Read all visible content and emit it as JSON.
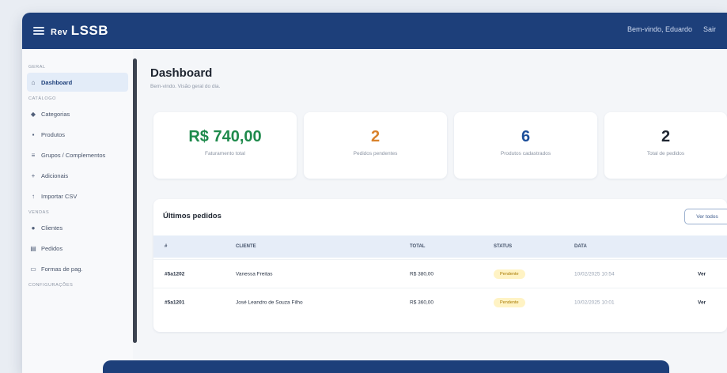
{
  "app": {
    "brand_prefix": "Rev",
    "brand_name": "LSSB",
    "user_label": "Bem-vindo, Eduardo",
    "user_extra": "Sair"
  },
  "sidebar": {
    "sections": [
      {
        "label": "GERAL",
        "items": [
          {
            "label": "Dashboard",
            "icon": "home-icon",
            "active": true
          }
        ]
      },
      {
        "label": "CATÁLOGO",
        "items": [
          {
            "label": "Categorias",
            "icon": "tag-icon"
          },
          {
            "label": "Produtos",
            "icon": "box-icon"
          },
          {
            "label": "Grupos / Complementos",
            "icon": "layers-icon"
          },
          {
            "label": "Adicionais",
            "icon": "plus-icon"
          },
          {
            "label": "Importar CSV",
            "icon": "upload-icon"
          }
        ]
      },
      {
        "label": "VENDAS",
        "items": [
          {
            "label": "Clientes",
            "icon": "users-icon"
          },
          {
            "label": "Pedidos",
            "icon": "receipt-icon"
          },
          {
            "label": "Formas de pag.",
            "icon": "card-icon"
          }
        ]
      },
      {
        "label": "CONFIGURAÇÕES",
        "items": []
      }
    ]
  },
  "main": {
    "title": "Dashboard",
    "subtitle": "Bem-vindo. Visão geral do dia."
  },
  "stats": [
    {
      "value": "R$ 740,00",
      "label": "Faturamento total",
      "color": "#1f8a4c"
    },
    {
      "value": "2",
      "label": "Pedidos pendentes",
      "color": "#d9822b"
    },
    {
      "value": "6",
      "label": "Produtos cadastrados",
      "color": "#1d4f9a"
    },
    {
      "value": "2",
      "label": "Total de pedidos",
      "color": "#1e2530"
    }
  ],
  "orders": {
    "title": "Últimos pedidos",
    "button_label": "Ver todos",
    "columns": [
      "#",
      "CLIENTE",
      "TOTAL",
      "STATUS",
      "DATA"
    ],
    "rows": [
      {
        "id": "#5a1202",
        "client": "Vanessa Freitas",
        "total": "R$ 380,00",
        "status": "Pendente",
        "date": "10/02/2025 10:54",
        "action": "Ver"
      },
      {
        "id": "#5a1201",
        "client": "José Leandro de Souza Filho",
        "total": "R$ 360,00",
        "status": "Pendente",
        "date": "10/02/2025 10:01",
        "action": "Ver"
      }
    ]
  }
}
